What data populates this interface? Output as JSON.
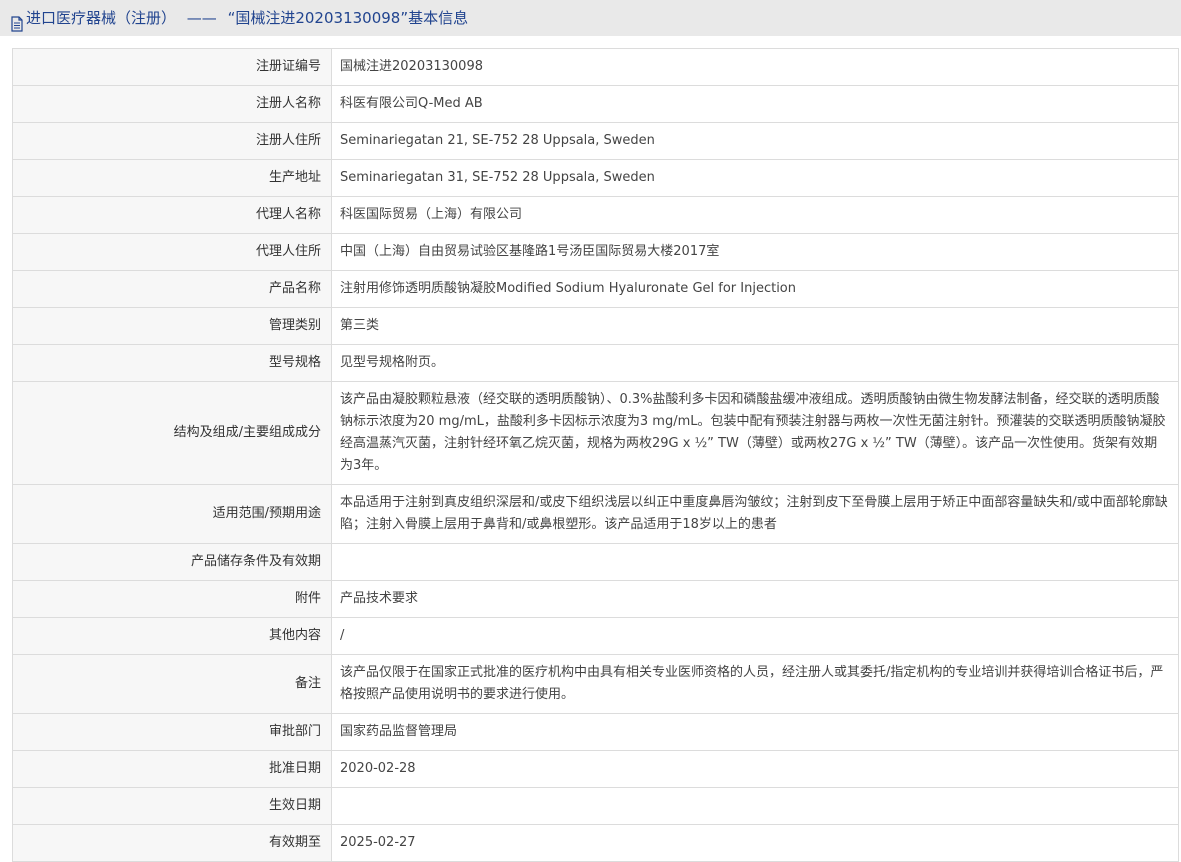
{
  "header": {
    "icon": "document-icon",
    "category": "进口医疗器械（注册）",
    "separator": "——",
    "title": "“国械注进20203130098”基本信息"
  },
  "colors": {
    "title_text": "#21448f",
    "title_bg": "#e9e9e9",
    "label_bg": "#f7f7f7",
    "border": "#dcdcdc"
  },
  "rows": [
    {
      "label": "注册证编号",
      "value": "国械注进20203130098"
    },
    {
      "label": "注册人名称",
      "value": "科医有限公司Q-Med AB"
    },
    {
      "label": "注册人住所",
      "value": "Seminariegatan 21, SE-752 28 Uppsala, Sweden"
    },
    {
      "label": "生产地址",
      "value": "Seminariegatan 31, SE-752 28 Uppsala, Sweden"
    },
    {
      "label": "代理人名称",
      "value": "科医国际贸易（上海）有限公司"
    },
    {
      "label": "代理人住所",
      "value": "中国（上海）自由贸易试验区基隆路1号汤臣国际贸易大楼2017室"
    },
    {
      "label": "产品名称",
      "value": "注射用修饰透明质酸钠凝胶Modified Sodium Hyaluronate Gel for Injection"
    },
    {
      "label": "管理类别",
      "value": "第三类"
    },
    {
      "label": "型号规格",
      "value": "见型号规格附页。"
    },
    {
      "label": "结构及组成/主要组成成分",
      "value": "该产品由凝胶颗粒悬液（经交联的透明质酸钠）、0.3%盐酸利多卡因和磷酸盐缓冲液组成。透明质酸钠由微生物发酵法制备，经交联的透明质酸钠标示浓度为20 mg/mL，盐酸利多卡因标示浓度为3 mg/mL。包装中配有预装注射器与两枚一次性无菌注射针。预灌装的交联透明质酸钠凝胶经高温蒸汽灭菌，注射针经环氧乙烷灭菌，规格为两枚29G x ½” TW（薄壁）或两枚27G x ½” TW（薄壁）。该产品一次性使用。货架有效期为3年。"
    },
    {
      "label": "适用范围/预期用途",
      "value": "本品适用于注射到真皮组织深层和/或皮下组织浅层以纠正中重度鼻唇沟皱纹；注射到皮下至骨膜上层用于矫正中面部容量缺失和/或中面部轮廓缺陷；注射入骨膜上层用于鼻背和/或鼻根塑形。该产品适用于18岁以上的患者"
    },
    {
      "label": "产品储存条件及有效期",
      "value": ""
    },
    {
      "label": "附件",
      "value": "产品技术要求"
    },
    {
      "label": "其他内容",
      "value": "/"
    },
    {
      "label": "备注",
      "value": "该产品仅限于在国家正式批准的医疗机构中由具有相关专业医师资格的人员，经注册人或其委托/指定机构的专业培训并获得培训合格证书后，严格按照产品使用说明书的要求进行使用。"
    },
    {
      "label": "审批部门",
      "value": "国家药品监督管理局"
    },
    {
      "label": "批准日期",
      "value": "2020-02-28"
    },
    {
      "label": "生效日期",
      "value": ""
    },
    {
      "label": "有效期至",
      "value": "2025-02-27"
    }
  ]
}
